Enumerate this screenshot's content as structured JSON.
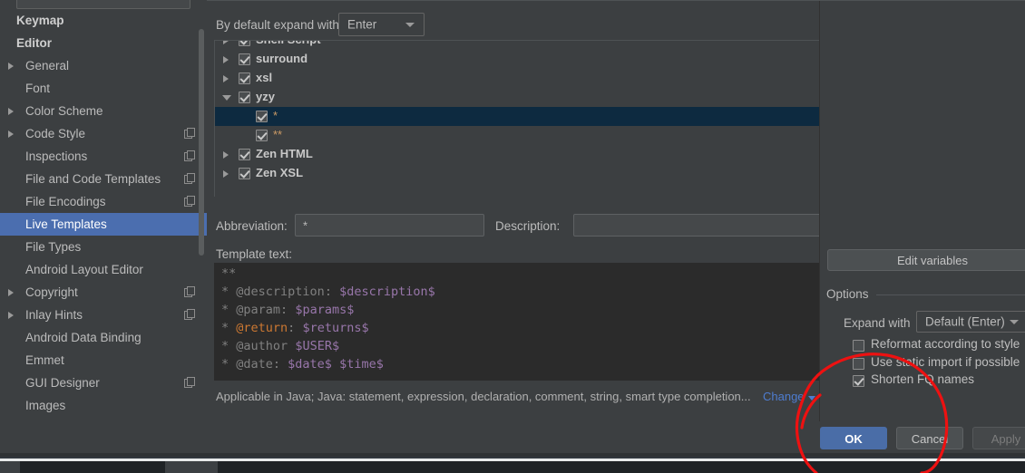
{
  "sidebar": {
    "scrollbar": "vertical-scrollbar",
    "help_label": "?",
    "items": [
      {
        "label": "Keymap",
        "bold": true,
        "arrow": false,
        "copy": false,
        "selected": false
      },
      {
        "label": "Editor",
        "bold": true,
        "arrow": false,
        "copy": false,
        "selected": false
      },
      {
        "label": "General",
        "bold": false,
        "arrow": true,
        "copy": false,
        "selected": false
      },
      {
        "label": "Font",
        "bold": false,
        "arrow": false,
        "copy": false,
        "selected": false
      },
      {
        "label": "Color Scheme",
        "bold": false,
        "arrow": true,
        "copy": false,
        "selected": false
      },
      {
        "label": "Code Style",
        "bold": false,
        "arrow": true,
        "copy": true,
        "selected": false
      },
      {
        "label": "Inspections",
        "bold": false,
        "arrow": false,
        "copy": true,
        "selected": false
      },
      {
        "label": "File and Code Templates",
        "bold": false,
        "arrow": false,
        "copy": true,
        "selected": false
      },
      {
        "label": "File Encodings",
        "bold": false,
        "arrow": false,
        "copy": true,
        "selected": false
      },
      {
        "label": "Live Templates",
        "bold": false,
        "arrow": false,
        "copy": false,
        "selected": true
      },
      {
        "label": "File Types",
        "bold": false,
        "arrow": false,
        "copy": false,
        "selected": false
      },
      {
        "label": "Android Layout Editor",
        "bold": false,
        "arrow": false,
        "copy": false,
        "selected": false
      },
      {
        "label": "Copyright",
        "bold": false,
        "arrow": true,
        "copy": true,
        "selected": false
      },
      {
        "label": "Inlay Hints",
        "bold": false,
        "arrow": true,
        "copy": true,
        "selected": false
      },
      {
        "label": "Android Data Binding",
        "bold": false,
        "arrow": false,
        "copy": false,
        "selected": false
      },
      {
        "label": "Emmet",
        "bold": false,
        "arrow": false,
        "copy": false,
        "selected": false
      },
      {
        "label": "GUI Designer",
        "bold": false,
        "arrow": false,
        "copy": true,
        "selected": false
      },
      {
        "label": "Images",
        "bold": false,
        "arrow": false,
        "copy": false,
        "selected": false
      }
    ]
  },
  "topbar": {
    "expand_label": "By default expand with",
    "expand_value": "Enter"
  },
  "tree": {
    "rows": [
      {
        "label": "Shell Script",
        "indent": 0,
        "arrow": "closed",
        "checked": true,
        "selected": false,
        "leaf": false,
        "clipped": true
      },
      {
        "label": "surround",
        "indent": 0,
        "arrow": "closed",
        "checked": true,
        "selected": false,
        "leaf": false,
        "clipped": false
      },
      {
        "label": "xsl",
        "indent": 0,
        "arrow": "closed",
        "checked": true,
        "selected": false,
        "leaf": false,
        "clipped": false
      },
      {
        "label": "yzy",
        "indent": 0,
        "arrow": "open",
        "checked": true,
        "selected": false,
        "leaf": false,
        "clipped": false
      },
      {
        "label": "*",
        "indent": 1,
        "arrow": "none",
        "checked": true,
        "selected": true,
        "leaf": true,
        "clipped": false
      },
      {
        "label": "**",
        "indent": 1,
        "arrow": "none",
        "checked": true,
        "selected": false,
        "leaf": true,
        "clipped": false
      },
      {
        "label": "Zen HTML",
        "indent": 0,
        "arrow": "closed",
        "checked": true,
        "selected": false,
        "leaf": false,
        "clipped": false
      },
      {
        "label": "Zen XSL",
        "indent": 0,
        "arrow": "closed",
        "checked": true,
        "selected": false,
        "leaf": false,
        "clipped": false
      }
    ]
  },
  "form": {
    "abbreviation_label": "Abbreviation:",
    "abbreviation_value": "*",
    "description_label": "Description:",
    "description_value": "",
    "template_text_label": "Template text:",
    "template_lines": [
      {
        "segments": [
          {
            "t": "**",
            "c": "k-com"
          }
        ]
      },
      {
        "segments": [
          {
            "t": "* ",
            "c": "k-com"
          },
          {
            "t": "@description",
            "c": "k-com"
          },
          {
            "t": ": ",
            "c": "k-com"
          },
          {
            "t": "$description$",
            "c": "k-var"
          }
        ]
      },
      {
        "segments": [
          {
            "t": "* ",
            "c": "k-com"
          },
          {
            "t": "@param",
            "c": "k-com"
          },
          {
            "t": ": ",
            "c": "k-com"
          },
          {
            "t": "$params$",
            "c": "k-var"
          }
        ]
      },
      {
        "segments": [
          {
            "t": "* ",
            "c": "k-com"
          },
          {
            "t": "@return",
            "c": "k-ret"
          },
          {
            "t": ": ",
            "c": "k-com"
          },
          {
            "t": "$returns$",
            "c": "k-var"
          }
        ]
      },
      {
        "segments": [
          {
            "t": "* ",
            "c": "k-com"
          },
          {
            "t": "@author",
            "c": "k-com"
          },
          {
            "t": " ",
            "c": "k-com"
          },
          {
            "t": "$USER$",
            "c": "k-var"
          }
        ]
      },
      {
        "segments": [
          {
            "t": "* ",
            "c": "k-com"
          },
          {
            "t": "@date",
            "c": "k-com"
          },
          {
            "t": ": ",
            "c": "k-com"
          },
          {
            "t": "$date$ $time$",
            "c": "k-var"
          }
        ]
      }
    ],
    "applicable_text": "Applicable in Java; Java: statement, expression, declaration, comment, string, smart type completion...",
    "change_link": "Change"
  },
  "options": {
    "edit_variables_label": "Edit variables",
    "title": "Options",
    "expand_with_label": "Expand with",
    "expand_with_value": "Default (Enter)",
    "checkboxes": [
      {
        "label": "Reformat according to style",
        "checked": false
      },
      {
        "label": "Use static import if possible",
        "checked": false
      },
      {
        "label": "Shorten FQ names",
        "checked": true
      }
    ]
  },
  "buttons": {
    "ok": "OK",
    "cancel": "Cancel",
    "apply": "Apply"
  },
  "colors": {
    "background": "#3c3f41",
    "selection": "#4b6eaf",
    "tree_selection": "#0d2a40",
    "accent_button": "#4a6da7",
    "link": "#4e7ccf",
    "editor_bg": "#2b2b2b",
    "annotation": "#ee1111",
    "leaf_text": "#cc9b66",
    "variable_text": "#9876aa",
    "keyword_text": "#cc7832"
  }
}
